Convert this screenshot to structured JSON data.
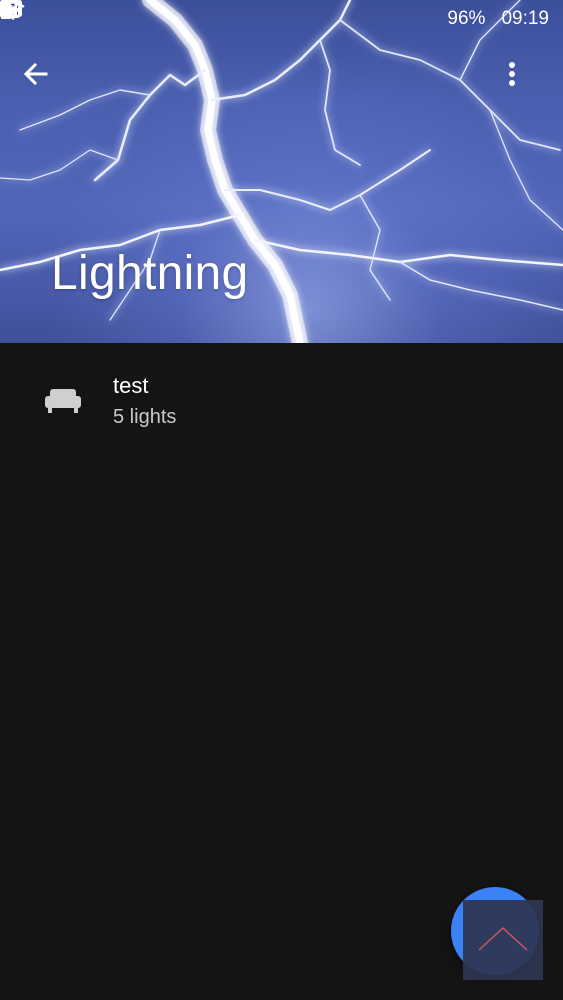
{
  "status_bar": {
    "battery_percent": "96%",
    "time": "09:19",
    "icons": [
      "gallery-icon",
      "gmail-icon",
      "mute-icon",
      "wifi-icon",
      "signal-icon",
      "battery-icon"
    ]
  },
  "toolbar": {
    "back_icon": "arrow-back-icon",
    "more_icon": "more-vert-icon"
  },
  "header": {
    "title": "Lightning"
  },
  "rooms": [
    {
      "name": "test",
      "subtitle": "5 lights",
      "icon": "sofa-icon"
    }
  ],
  "fab": {
    "icon": "chevron-up-icon",
    "color": "#3b82f6",
    "accent": "#d9534f"
  }
}
